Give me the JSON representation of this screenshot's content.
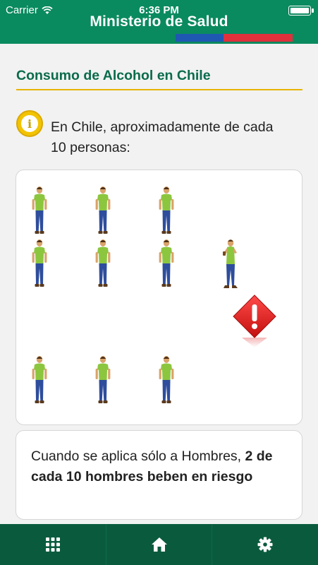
{
  "status_bar": {
    "carrier": "Carrier",
    "time": "6:36 PM"
  },
  "header": {
    "title": "Ministerio de Salud"
  },
  "page": {
    "title": "Consumo de Alcohol en Chile"
  },
  "info": {
    "icon": "info-icon",
    "text": "En Chile, aproximadamente de cada 10 personas:"
  },
  "illustration": {
    "normal_person_count": 9,
    "drinker_count": 1,
    "warning_icon": "warning-exclamation-icon"
  },
  "summary": {
    "text_normal": "Cuando se aplica sólo a Hombres, ",
    "text_bold": "2 de cada 10 hombres beben en riesgo"
  },
  "tabbar": {
    "items": [
      {
        "icon": "grid-icon"
      },
      {
        "icon": "home-icon"
      },
      {
        "icon": "gear-icon"
      }
    ]
  },
  "colors": {
    "header_green": "#0a8a5f",
    "tabbar_green": "#0a5b3e",
    "title_green": "#0a6b4c",
    "rule_yellow": "#e8b400",
    "flag_blue": "#1f58b3",
    "flag_red": "#e0303c"
  }
}
